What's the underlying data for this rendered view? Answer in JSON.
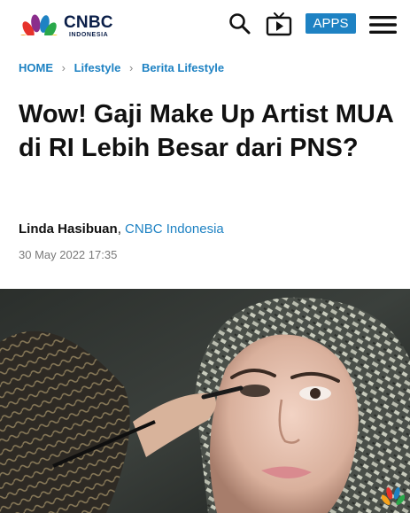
{
  "header": {
    "logo": {
      "brand": "CNBC",
      "sub": "INDONESIA"
    },
    "icons": {
      "search": "search-icon",
      "tv": "tv-icon",
      "menu": "hamburger-menu-icon"
    },
    "apps_label": "APPS",
    "colors": {
      "accent": "#1e82c3",
      "brand_dark": "#0a1e48"
    }
  },
  "breadcrumb": {
    "items": [
      "HOME",
      "Lifestyle",
      "Berita Lifestyle"
    ],
    "separator": "›"
  },
  "article": {
    "title": "Wow! Gaji Make Up Artist MUA di RI Lebih Besar dari PNS?",
    "author": "Linda Hasibuan",
    "author_separator": ",",
    "source": "CNBC Indonesia",
    "date": "30 May 2022 17:35"
  },
  "hero": {
    "subject": "makeup-artist-applying-eyeliner-photo",
    "watermark": {
      "text": "CNBC"
    }
  }
}
